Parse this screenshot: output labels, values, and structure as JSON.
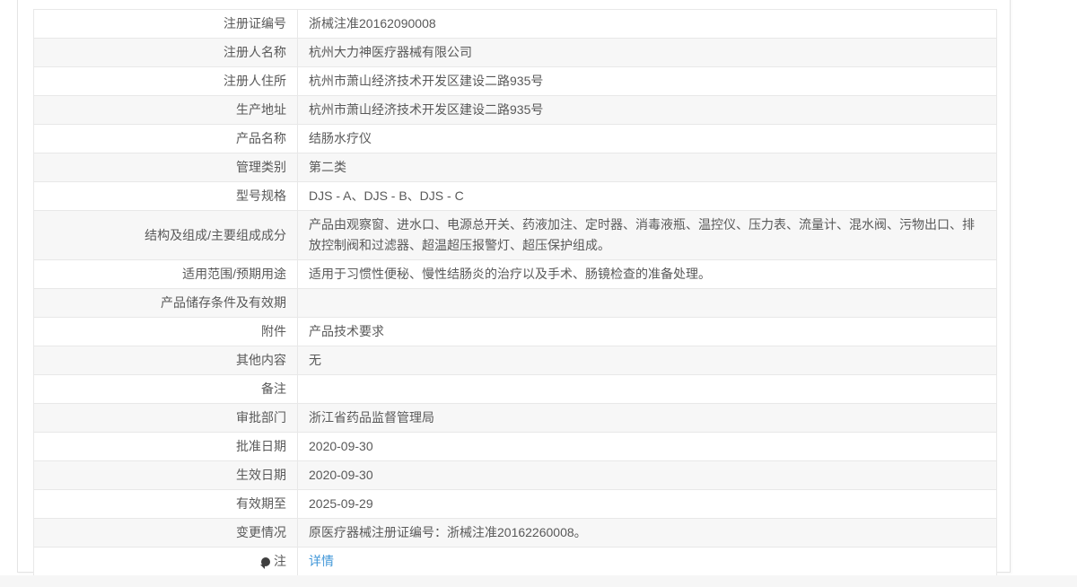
{
  "colors": {
    "link": "#4197d8",
    "row_stripe": "#f7f7f7",
    "table_border": "#e8e8e8",
    "text": "#595959"
  },
  "table": {
    "rows": [
      {
        "label": "注册证编号",
        "value": "浙械注准20162090008"
      },
      {
        "label": "注册人名称",
        "value": "杭州大力神医疗器械有限公司"
      },
      {
        "label": "注册人住所",
        "value": "杭州市萧山经济技术开发区建设二路935号"
      },
      {
        "label": "生产地址",
        "value": "杭州市萧山经济技术开发区建设二路935号"
      },
      {
        "label": "产品名称",
        "value": "结肠水疗仪"
      },
      {
        "label": "管理类别",
        "value": "第二类"
      },
      {
        "label": "型号规格",
        "value": "DJS - A、DJS - B、DJS - C"
      },
      {
        "label": "结构及组成/主要组成成分",
        "value": "产品由观察窗、进水口、电源总开关、药液加注、定时器、消毒液瓶、温控仪、压力表、流量计、混水阀、污物出口、排放控制阀和过滤器、超温超压报警灯、超压保护组成。"
      },
      {
        "label": "适用范围/预期用途",
        "value": "适用于习惯性便秘、慢性结肠炎的治疗以及手术、肠镜检查的准备处理。"
      },
      {
        "label": "产品储存条件及有效期",
        "value": ""
      },
      {
        "label": "附件",
        "value": "产品技术要求"
      },
      {
        "label": "其他内容",
        "value": "无"
      },
      {
        "label": "备注",
        "value": ""
      },
      {
        "label": "审批部门",
        "value": "浙江省药品监督管理局"
      },
      {
        "label": "批准日期",
        "value": "2020-09-30"
      },
      {
        "label": "生效日期",
        "value": "2020-09-30"
      },
      {
        "label": "有效期至",
        "value": "2025-09-29"
      },
      {
        "label": "变更情况",
        "value": "原医疗器械注册证编号：浙械注准20162260008。"
      },
      {
        "label": "注",
        "icon": "note-balloon-icon",
        "link": "详情"
      }
    ]
  }
}
